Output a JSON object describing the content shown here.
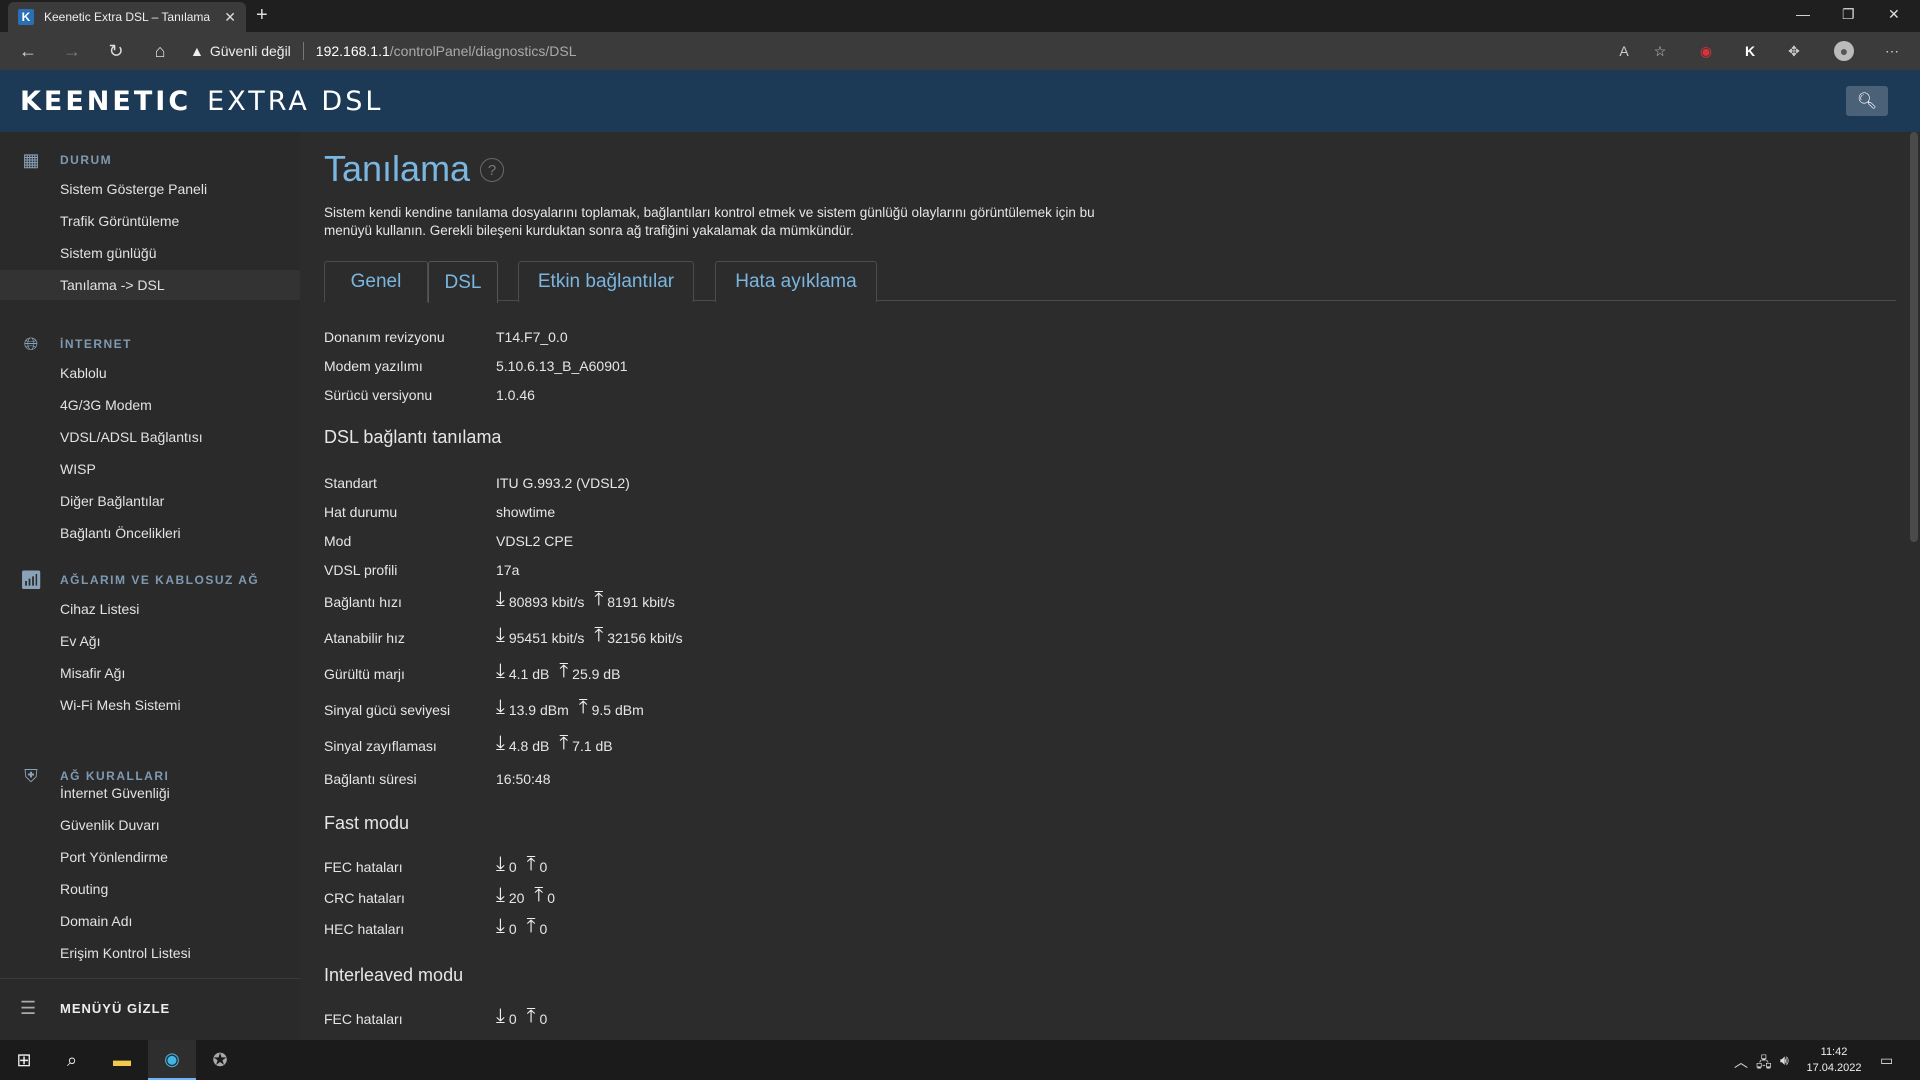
{
  "browser": {
    "tab_title": "Keenetic Extra DSL – Tanılama",
    "tab_favicon": "K",
    "new_tab": "+",
    "address_warning": "Güvenli değil",
    "address_host": "192.168.1.1",
    "address_path": "/controlPanel/diagnostics/DSL"
  },
  "app": {
    "brand_bold": "KEENETIC",
    "brand_model": "EXTRA DSL"
  },
  "sidebar": {
    "sections": [
      {
        "title": "DURUM",
        "icon": "dashboard-icon",
        "items": [
          "Sistem Gösterge Paneli",
          "Trafik Görüntüleme",
          "Sistem günlüğü",
          "Tanılama -> DSL"
        ]
      },
      {
        "title": "İNTERNET",
        "icon": "globe-icon",
        "items": [
          "Kablolu",
          "4G/3G Modem",
          "VDSL/ADSL Bağlantısı",
          "WISP",
          "Diğer Bağlantılar",
          "Bağlantı Öncelikleri"
        ]
      },
      {
        "title": "AĞLARIM VE KABLOSUZ AĞ",
        "icon": "wifi-icon",
        "items": [
          "Cihaz Listesi",
          "Ev Ağı",
          "Misafir Ağı",
          "Wi-Fi Mesh Sistemi"
        ]
      },
      {
        "title": "AĞ KURALLARI",
        "icon": "shield-icon",
        "items": [
          "İnternet Güvenliği",
          "Güvenlik Duvarı",
          "Port Yönlendirme",
          "Routing",
          "Domain Adı",
          "Erişim Kontrol Listesi"
        ]
      }
    ],
    "hide_menu": "MENÜYÜ GİZLE"
  },
  "page": {
    "title": "Tanılama",
    "help": "?",
    "description": "Sistem kendi kendine tanılama dosyalarını toplamak, bağlantıları kontrol etmek ve sistem günlüğü olaylarını görüntülemek için bu menüyü kullanın. Gerekli bileşeni kurduktan sonra ağ trafiğini yakalamak da mümkündür.",
    "tabs": [
      "Genel",
      "DSL",
      "Etkin bağlantılar",
      "Hata ayıklama"
    ],
    "active_tab": "DSL",
    "hw": [
      {
        "label": "Donanım revizyonu",
        "value": "T14.F7_0.0"
      },
      {
        "label": "Modem yazılımı",
        "value": "5.10.6.13_B_A60901"
      },
      {
        "label": "Sürücü versiyonu",
        "value": "1.0.46"
      }
    ],
    "dsl_heading": "DSL bağlantı tanılama",
    "dsl_simple": [
      {
        "label": "Standart",
        "value": "ITU G.993.2 (VDSL2)"
      },
      {
        "label": "Hat durumu",
        "value": "showtime"
      },
      {
        "label": "Mod",
        "value": "VDSL2 CPE"
      },
      {
        "label": "VDSL profili",
        "value": "17a"
      }
    ],
    "dsl_pairs": [
      {
        "label": "Bağlantı hızı",
        "down": "80893 kbit/s",
        "up": "8191 kbit/s"
      },
      {
        "label": "Atanabilir hız",
        "down": "95451 kbit/s",
        "up": "32156 kbit/s"
      },
      {
        "label": "Gürültü marjı",
        "down": "4.1 dB",
        "up": "25.9 dB"
      },
      {
        "label": "Sinyal gücü seviyesi",
        "down": "13.9 dBm",
        "up": "9.5 dBm"
      },
      {
        "label": "Sinyal zayıflaması",
        "down": "4.8 dB",
        "up": "7.1 dB"
      }
    ],
    "uptime": {
      "label": "Bağlantı süresi",
      "value": "16:50:48"
    },
    "fast_heading": "Fast modu",
    "fast": [
      {
        "label": "FEC hataları",
        "down": "0",
        "up": "0"
      },
      {
        "label": "CRC hataları",
        "down": "20",
        "up": "0"
      },
      {
        "label": "HEC hataları",
        "down": "0",
        "up": "0"
      }
    ],
    "interleaved_heading": "Interleaved modu",
    "interleaved": [
      {
        "label": "FEC hataları",
        "down": "0",
        "up": "0"
      }
    ]
  },
  "taskbar": {
    "time": "11:42",
    "date": "17.04.2022"
  },
  "colors": {
    "header_bg": "#1c3a55",
    "accent": "#7ab6e0",
    "sidebar_section": "#7e9ab3"
  }
}
